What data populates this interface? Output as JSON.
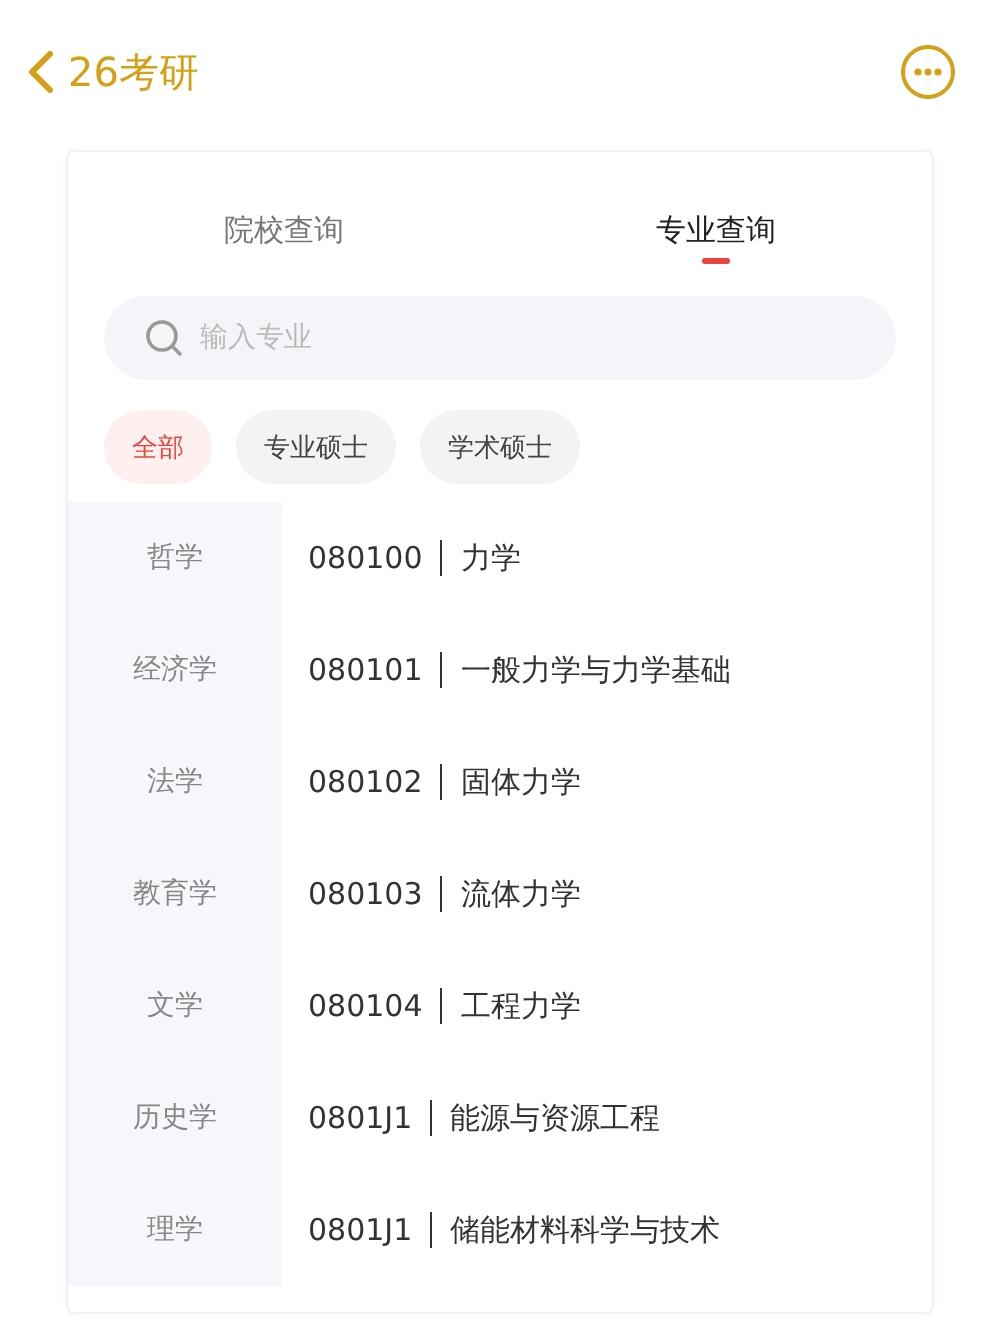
{
  "header": {
    "title": "26考研"
  },
  "tabs": [
    {
      "label": "院校查询",
      "selected": false
    },
    {
      "label": "专业查询",
      "selected": true
    }
  ],
  "search": {
    "placeholder": "输入专业"
  },
  "filters": [
    {
      "label": "全部",
      "selected": true
    },
    {
      "label": "专业硕士",
      "selected": false
    },
    {
      "label": "学术硕士",
      "selected": false
    }
  ],
  "categories": [
    "哲学",
    "经济学",
    "法学",
    "教育学",
    "文学",
    "历史学",
    "理学"
  ],
  "majors": [
    {
      "code": "080100",
      "name": "力学"
    },
    {
      "code": "080101",
      "name": "一般力学与力学基础"
    },
    {
      "code": "080102",
      "name": "固体力学"
    },
    {
      "code": "080103",
      "name": "流体力学"
    },
    {
      "code": "080104",
      "name": "工程力学"
    },
    {
      "code": "0801J1",
      "name": "能源与资源工程"
    },
    {
      "code": "0801J1",
      "name": "储能材料科学与技术"
    }
  ]
}
